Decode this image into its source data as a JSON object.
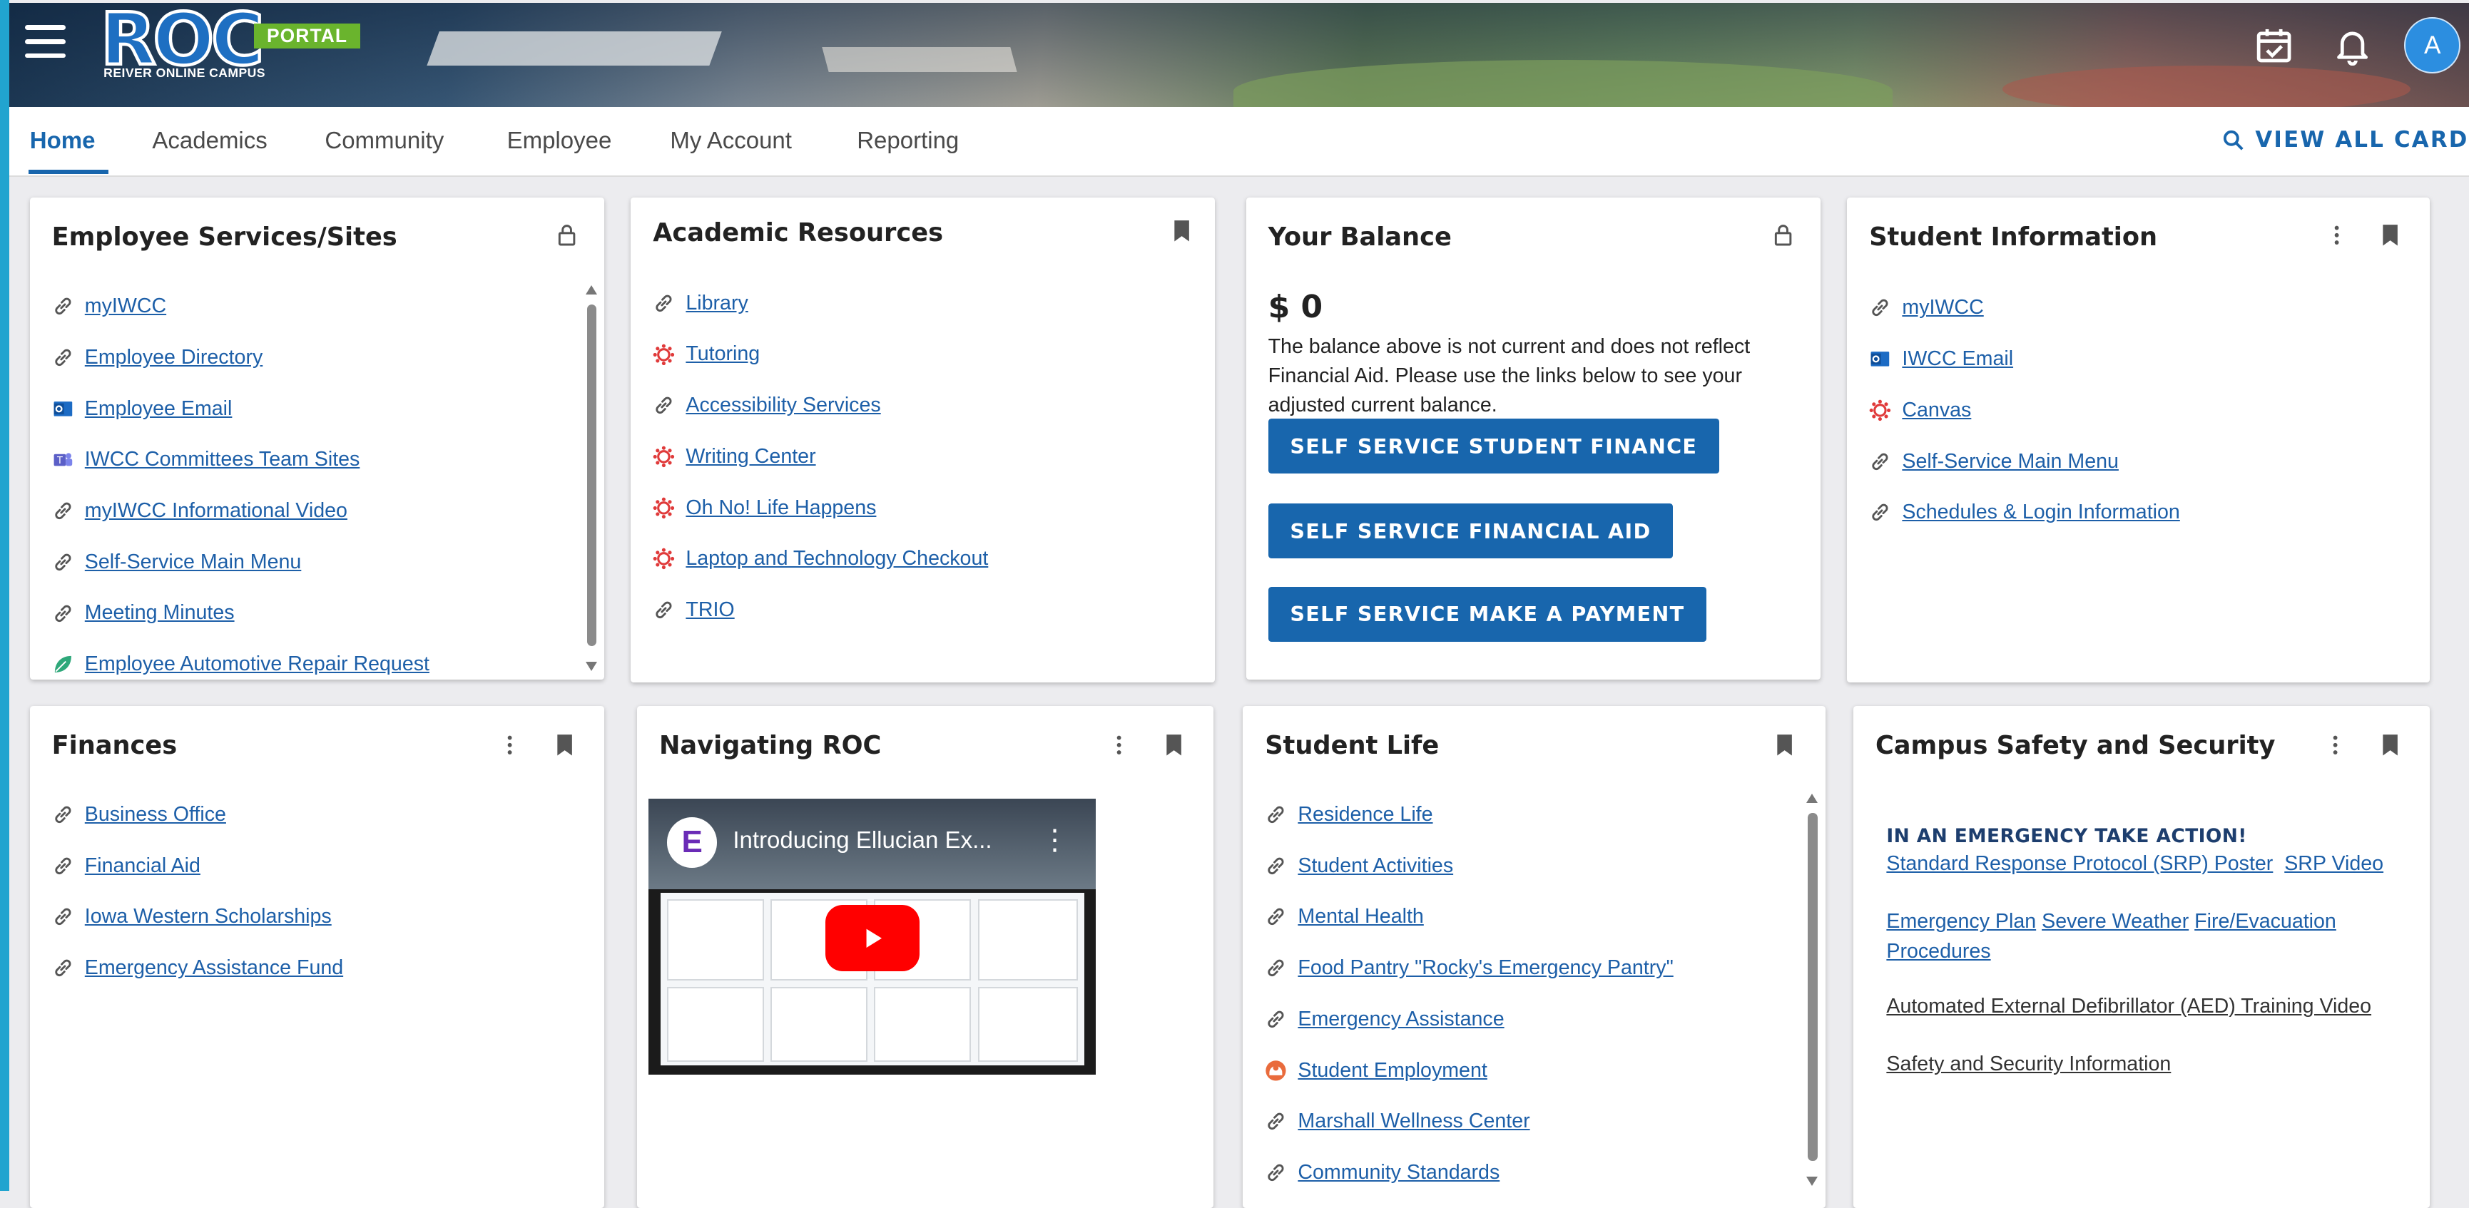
{
  "header": {
    "logo_text": "ROC",
    "logo_badge": "PORTAL",
    "logo_subtitle": "REIVER ONLINE CAMPUS",
    "avatar_initial": "A"
  },
  "nav": {
    "tabs": [
      "Home",
      "Academics",
      "Community",
      "Employee",
      "My Account",
      "Reporting"
    ],
    "view_all": "VIEW ALL CARDS"
  },
  "cards": {
    "employee_services": {
      "title": "Employee Services/Sites",
      "links": [
        "myIWCC",
        "Employee Directory",
        "Employee Email",
        "IWCC Committees Team Sites",
        "myIWCC Informational Video",
        "Self-Service Main Menu",
        "Meeting Minutes",
        "Employee Automotive Repair Request"
      ]
    },
    "academic_resources": {
      "title": "Academic Resources",
      "links": [
        "Library",
        "Tutoring",
        "Accessibility Services",
        "Writing Center",
        "Oh No! Life Happens",
        "Laptop and Technology Checkout",
        "TRIO"
      ]
    },
    "your_balance": {
      "title": "Your Balance",
      "amount": "$ 0",
      "note": "The balance above is not current and does not reflect Financial Aid. Please use the links below to see your adjusted current balance.",
      "buttons": [
        "SELF SERVICE STUDENT FINANCE",
        "SELF SERVICE FINANCIAL AID",
        "SELF SERVICE MAKE A PAYMENT"
      ]
    },
    "student_information": {
      "title": "Student Information",
      "links": [
        "myIWCC",
        "IWCC Email",
        "Canvas",
        "Self-Service Main Menu",
        "Schedules & Login Information"
      ]
    },
    "finances": {
      "title": "Finances",
      "links": [
        "Business Office",
        "Financial Aid",
        "Iowa Western Scholarships",
        "Emergency Assistance Fund"
      ]
    },
    "navigating_roc": {
      "title": "Navigating ROC",
      "video_title": "Introducing Ellucian Ex...",
      "video_logo": "E"
    },
    "student_life": {
      "title": "Student Life",
      "links": [
        "Residence Life",
        "Student Activities",
        "Mental Health",
        "Food Pantry \"Rocky's Emergency Pantry\"",
        "Emergency Assistance",
        "Student Employment",
        "Marshall Wellness Center",
        "Community Standards"
      ]
    },
    "campus_safety": {
      "title": "Campus Safety and Security",
      "heading": "IN AN EMERGENCY TAKE ACTION!",
      "srp_poster": "Standard Response Protocol (SRP) Poster",
      "srp_video": "SRP Video",
      "emergency_plan": "Emergency Plan",
      "severe_weather": "Severe Weather",
      "fire_evac": "Fire/Evacuation Procedures",
      "aed": "Automated External Defibrillator (AED) Training Video",
      "safety_info": "Safety and Security Information"
    }
  },
  "colors": {
    "accent": "#1866ad",
    "link": "#1d5fa8",
    "rail": "#21a4cf",
    "logo_badge": "#6ab42d"
  }
}
